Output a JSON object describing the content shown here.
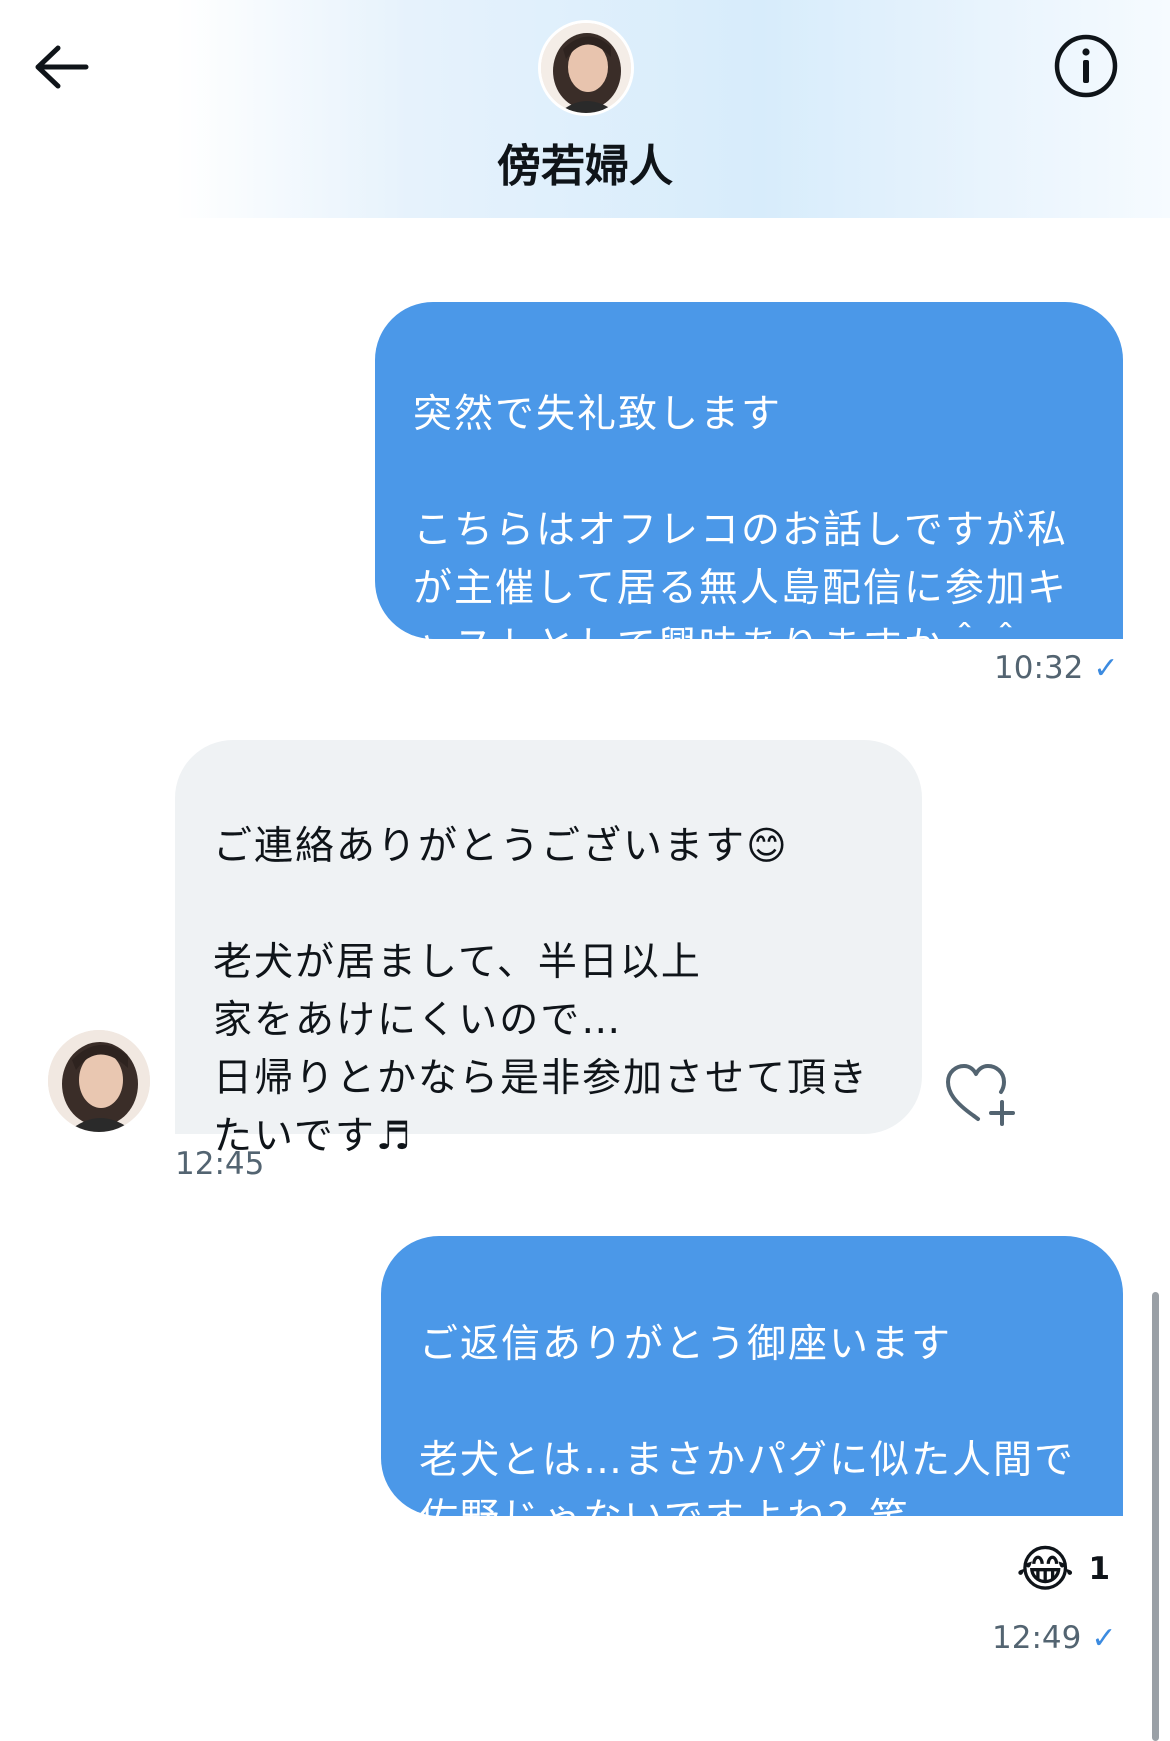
{
  "header": {
    "contact_name": "傍若婦人",
    "back_icon": "arrow-left-icon",
    "info_icon": "info-circle-icon"
  },
  "messages": [
    {
      "direction": "outgoing",
      "text": "突然で失礼致します\n\nこちらはオフレコのお話しですが私が主催して居る無人島配信に参加キャストとして興味ありますか＾＾",
      "time": "10:32",
      "status_icon": "check-icon"
    },
    {
      "direction": "incoming",
      "text": "ご連絡ありがとうございます😊\n\n老犬が居まして、半日以上\n家をあけにくいので…\n日帰りとかなら是非参加させて頂きたいです♬",
      "time": "12:45",
      "react_icon": "heart-plus-icon"
    },
    {
      "direction": "outgoing",
      "text": "ご返信ありがとう御座います\n\n老犬とは…まさかパグに似た人間で佐野じゃないですよね？笑",
      "time": "12:49",
      "status_icon": "check-icon",
      "reaction": {
        "emoji": "😂",
        "count": "1"
      }
    }
  ],
  "colors": {
    "outgoing_bubble": "#4b98e8",
    "incoming_bubble": "#eff2f4",
    "check": "#3c8be0",
    "time_text": "#536471"
  }
}
